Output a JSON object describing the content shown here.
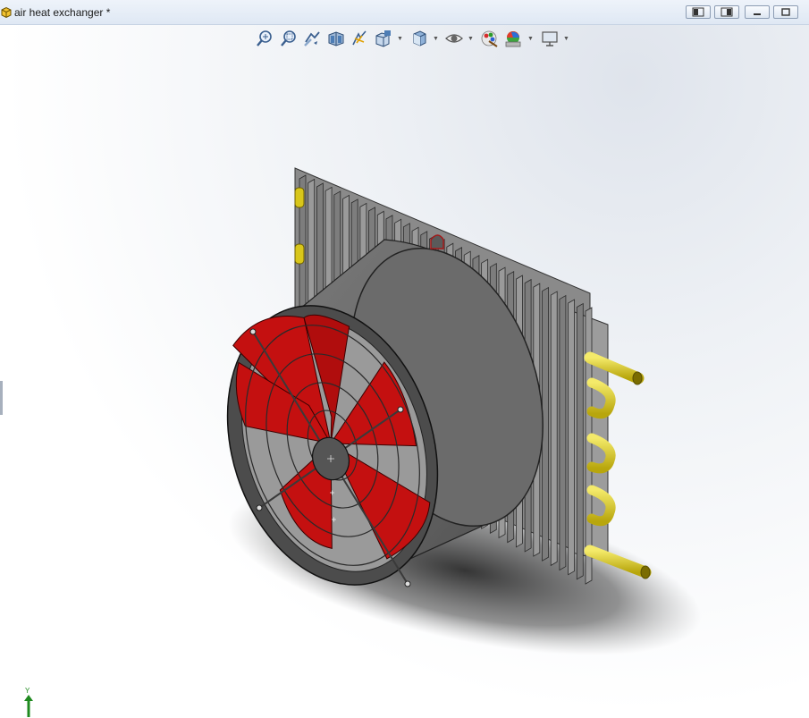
{
  "window": {
    "title": "air heat exchanger *",
    "icon": "part-document-icon"
  },
  "window_controls": [
    {
      "name": "tile-left-icon",
      "glyph": "◫"
    },
    {
      "name": "tile-right-icon",
      "glyph": "◫"
    },
    {
      "name": "minimize-icon",
      "glyph": "▁"
    },
    {
      "name": "restore-icon",
      "glyph": "❐"
    },
    {
      "name": "close-icon",
      "glyph": "✕"
    }
  ],
  "heads_up_toolbar": [
    "zoom-to-fit-icon",
    "zoom-to-area-icon",
    "previous-view-icon",
    "section-view-icon",
    "dynamic-annotation-icon",
    "view-orientation-icon",
    "display-style-icon",
    "hide-show-items-icon",
    "edit-appearance-icon",
    "apply-scene-icon",
    "view-settings-icon"
  ],
  "colors": {
    "fan_blades": "#c41010",
    "housing": "#6e6e6e",
    "fins": "#8a8a8a",
    "pipes": "#e3d21c",
    "axis_y": "#1f8a1f"
  },
  "triad": {
    "axis_label": "Y"
  }
}
